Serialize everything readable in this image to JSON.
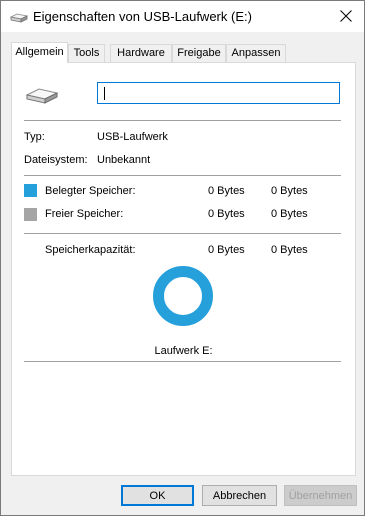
{
  "window": {
    "title": "Eigenschaften von USB-Laufwerk (E:)",
    "icons": {
      "title": "usb-drive-icon",
      "close": "close-icon"
    }
  },
  "tabs": [
    {
      "label": "Allgemein",
      "active": true
    },
    {
      "label": "Tools",
      "active": false
    },
    {
      "label": "Hardware",
      "active": false
    },
    {
      "label": "Freigabe",
      "active": false
    },
    {
      "label": "Anpassen",
      "active": false
    }
  ],
  "general": {
    "drive_icon": "usb-drive-icon",
    "name_value": "",
    "type_label": "Typ:",
    "type_value": "USB-Laufwerk",
    "fs_label": "Dateisystem:",
    "fs_value": "Unbekannt",
    "used": {
      "label": "Belegter Speicher:",
      "bytes": "0 Bytes",
      "size": "0 Bytes",
      "color": "#26a0da"
    },
    "free": {
      "label": "Freier Speicher:",
      "bytes": "0 Bytes",
      "size": "0 Bytes",
      "color": "#a5a5a5"
    },
    "capacity": {
      "label": "Speicherkapazität:",
      "bytes": "0 Bytes",
      "size": "0 Bytes"
    },
    "drive_label": "Laufwerk E:",
    "donut_color": "#26a0da"
  },
  "buttons": {
    "ok": "OK",
    "cancel": "Abbrechen",
    "apply": "Übernehmen",
    "apply_enabled": false
  }
}
